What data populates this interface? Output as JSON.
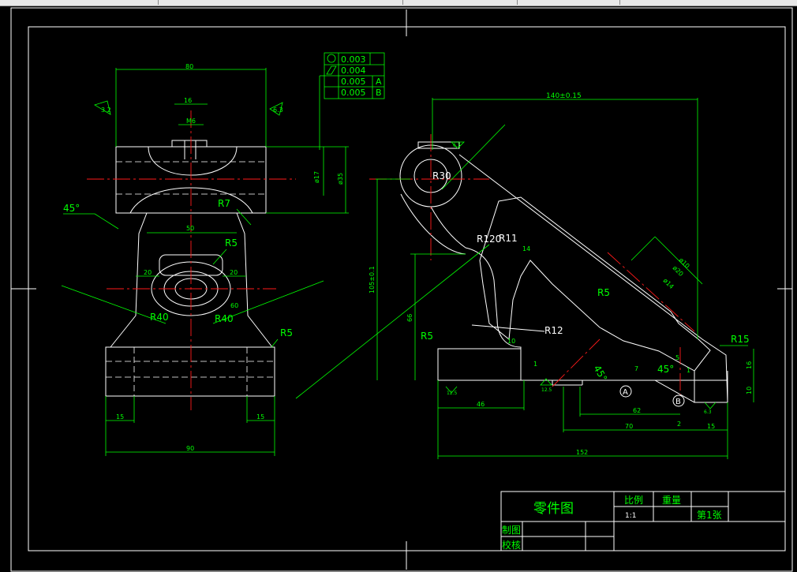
{
  "drawing": {
    "dims": {
      "d80": "80",
      "d16": "16",
      "m6": "M6",
      "d17": "ø17",
      "d35": "ø35",
      "ang45a": "45°",
      "r7": "R7",
      "d50": "50",
      "r5a": "R5",
      "d20a": "20",
      "d20b": "20",
      "r40a": "R40",
      "r40b": "R40",
      "d60": "60",
      "r5b": "R5",
      "d15a": "15",
      "d15b": "15",
      "d90": "90",
      "d140": "140±0.15",
      "r30": "R30",
      "r120": "R120",
      "r11": "R11",
      "r12": "R12",
      "d105": "105±0.1",
      "d66": "66",
      "r5c": "R5",
      "r5d": "R5",
      "d10": "10",
      "d14": "14",
      "ang45b": "45°",
      "ang45c": "45°",
      "d46": "46",
      "d62": "62",
      "d70": "70",
      "d2": "2",
      "d152": "152",
      "d15c": "15",
      "r15": "R15",
      "d10b": "10",
      "d1": "1",
      "d7": "7",
      "d1b": "1",
      "d5": "5",
      "phi10": "ø10",
      "phi20": "ø20",
      "phi14": "ø14",
      "datumA": "A",
      "datumB": "B"
    },
    "rough": {
      "r1": "3.2",
      "r2": "6.3",
      "r3": "12.5",
      "r4": "12.5",
      "r5": "6.3",
      "r6": "6.3"
    },
    "tolerance_frame": {
      "row1": "0.003",
      "row2": "0.004",
      "row3_val": "0.005",
      "row3_ref": "A",
      "row4_val": "0.005",
      "row4_ref": "B"
    }
  },
  "title_block": {
    "title": "零件图",
    "scale_label": "比例",
    "weight_label": "重量",
    "scale_value": "1:1",
    "sheet_label": "第1张",
    "drawn_label": "制图",
    "checked_label": "校核"
  },
  "colors": {
    "outline": "#ffffff",
    "dimension": "#00ff00",
    "centerline": "#ff1a1a",
    "background": "#000000"
  }
}
